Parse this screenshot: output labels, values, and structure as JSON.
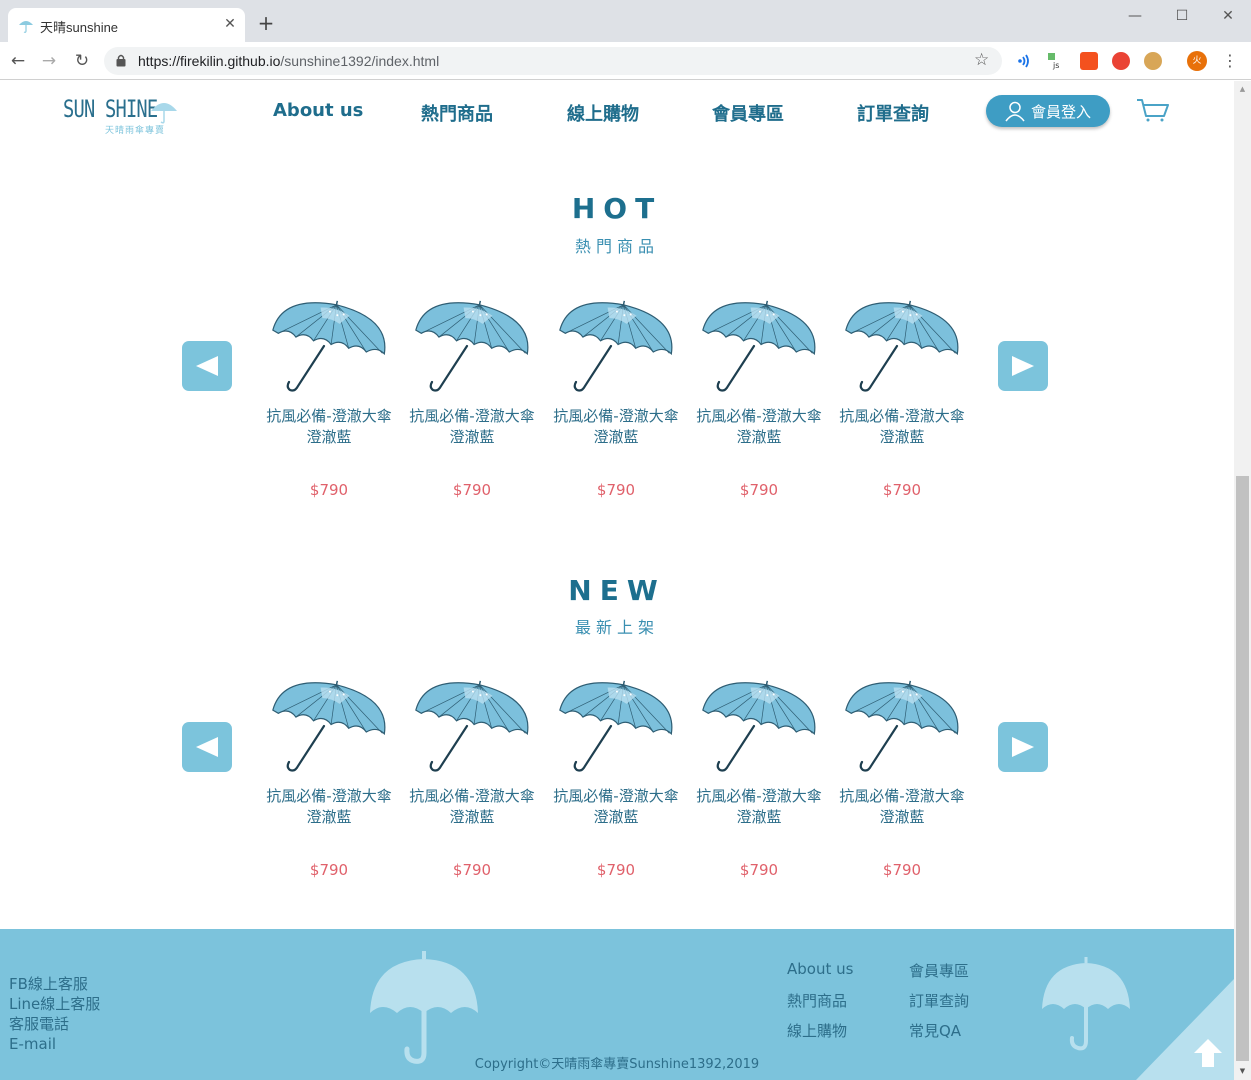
{
  "browser": {
    "tab_title": "天晴sunshine",
    "tab_close": "✕",
    "new_tab": "+",
    "window_controls": {
      "minimize": "—",
      "maximize": "☐",
      "close": "✕"
    },
    "url_host": "https://firekilin.github.io",
    "url_path": "/sunshine1392/index.html",
    "nav": {
      "back": "←",
      "forward": "→",
      "reload": "↻"
    },
    "star": "☆",
    "profile_initial": "火",
    "menu": "⋮"
  },
  "header": {
    "logo_text": "SUN SHINE",
    "logo_sub": "天晴雨傘專賣",
    "nav": [
      "About us",
      "熱門商品",
      "線上購物",
      "會員專區",
      "訂單查詢"
    ],
    "login_label": "會員登入"
  },
  "sections": [
    {
      "title": "HOT",
      "subtitle": "熱門商品",
      "products": [
        {
          "name": "抗風必備-澄澈大傘\n澄澈藍",
          "price": "$790"
        },
        {
          "name": "抗風必備-澄澈大傘\n澄澈藍",
          "price": "$790"
        },
        {
          "name": "抗風必備-澄澈大傘\n澄澈藍",
          "price": "$790"
        },
        {
          "name": "抗風必備-澄澈大傘\n澄澈藍",
          "price": "$790"
        },
        {
          "name": "抗風必備-澄澈大傘\n澄澈藍",
          "price": "$790"
        }
      ]
    },
    {
      "title": "NEW",
      "subtitle": "最新上架",
      "products": [
        {
          "name": "抗風必備-澄澈大傘\n澄澈藍",
          "price": "$790"
        },
        {
          "name": "抗風必備-澄澈大傘\n澄澈藍",
          "price": "$790"
        },
        {
          "name": "抗風必備-澄澈大傘\n澄澈藍",
          "price": "$790"
        },
        {
          "name": "抗風必備-澄澈大傘\n澄澈藍",
          "price": "$790"
        },
        {
          "name": "抗風必備-澄澈大傘\n澄澈藍",
          "price": "$790"
        }
      ]
    }
  ],
  "footer": {
    "contact": [
      "FB線上客服",
      "Line線上客服",
      "客服電話",
      "E-mail"
    ],
    "links_col1": [
      "About us",
      "熱門商品",
      "線上購物"
    ],
    "links_col2": [
      "會員專區",
      "訂單查詢",
      "常見QA"
    ],
    "copyright": "Copyright©天晴雨傘專賣Sunshine1392,2019"
  },
  "colors": {
    "brand": "#1d6f8e",
    "accent": "#7cc4dc",
    "price": "#e0616b",
    "footer_bg": "#7cc3dc",
    "login_btn": "#3e9dc4"
  },
  "icons": [
    "umbrella-favicon-icon",
    "lock-icon",
    "star-icon",
    "user-icon",
    "cart-icon",
    "arrow-left-icon",
    "arrow-right-icon",
    "umbrella-icon",
    "arrow-up-icon"
  ]
}
